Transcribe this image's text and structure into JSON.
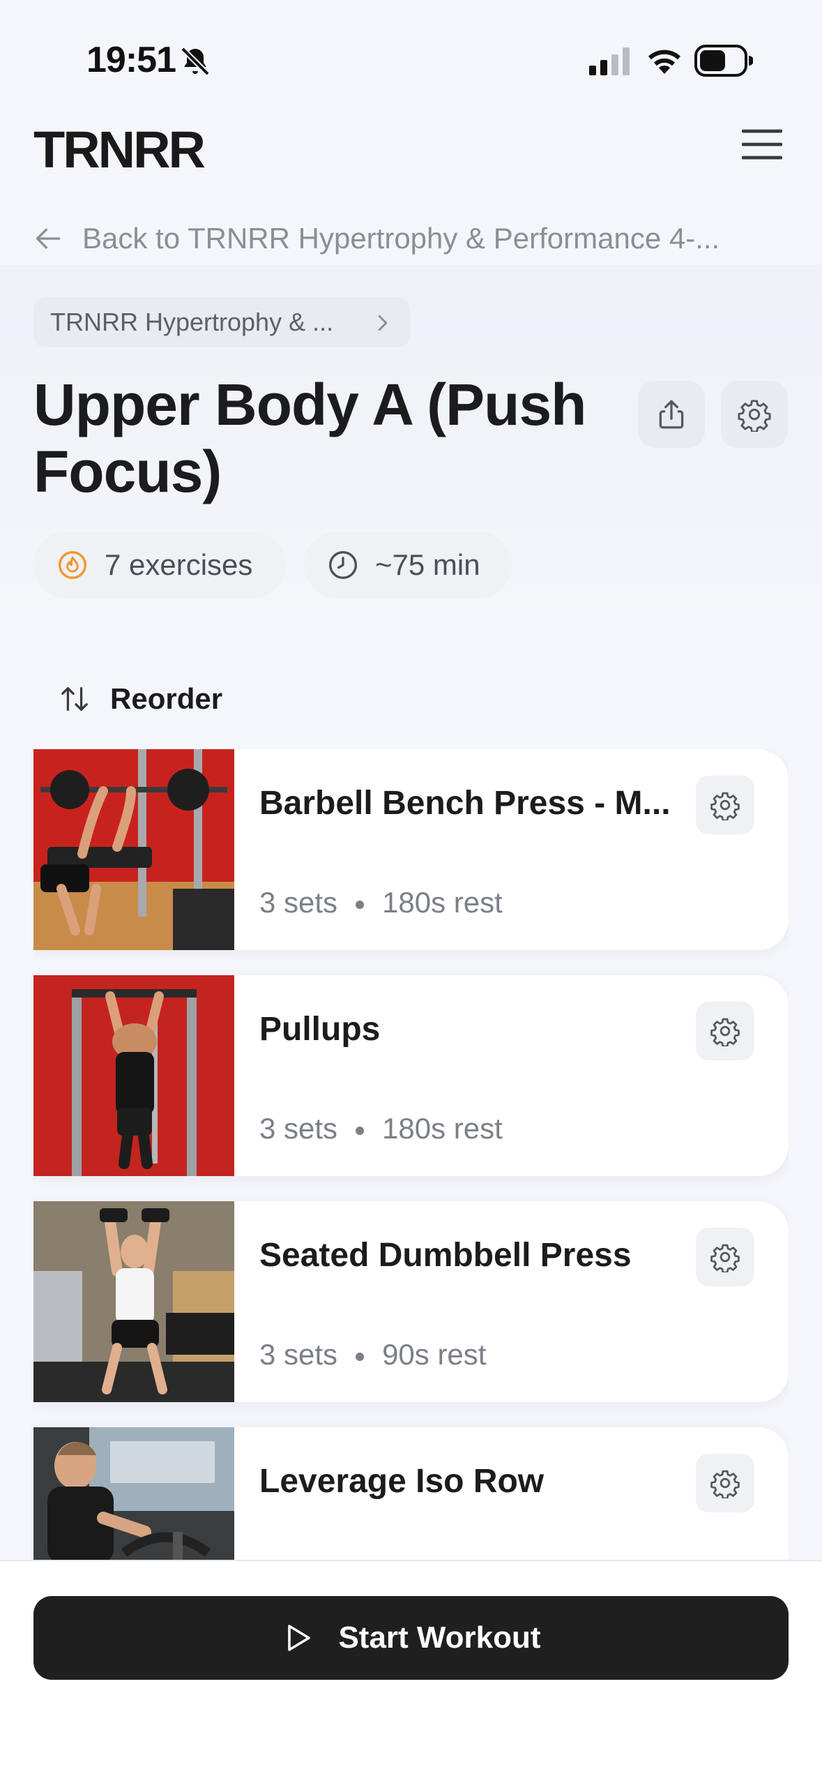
{
  "status_bar": {
    "time": "19:51",
    "icons": [
      "bell-slash-icon",
      "cellular-signal-icon",
      "wifi-icon",
      "battery-icon"
    ]
  },
  "header": {
    "brand": "TRNRR",
    "menu_icon": "hamburger-menu-icon"
  },
  "back_link": {
    "label": "Back to TRNRR Hypertrophy & Performance 4-..."
  },
  "breadcrumb": {
    "label": "TRNRR Hypertrophy & ..."
  },
  "workout": {
    "title": "Upper Body A (Push Focus)",
    "exercises_label": "7 exercises",
    "duration_label": "~75 min"
  },
  "reorder_label": "Reorder",
  "exercises": [
    {
      "name": "Barbell Bench Press - M...",
      "sets": "3 sets",
      "rest": "180s rest"
    },
    {
      "name": "Pullups",
      "sets": "3 sets",
      "rest": "180s rest"
    },
    {
      "name": "Seated Dumbbell Press",
      "sets": "3 sets",
      "rest": "90s rest"
    },
    {
      "name": "Leverage Iso Row",
      "sets": "",
      "rest": ""
    }
  ],
  "start_button": {
    "label": "Start Workout"
  },
  "colors": {
    "accent_orange": "#f0962d",
    "button_dark": "#1f1f1f",
    "background": "#f4f6fb"
  }
}
